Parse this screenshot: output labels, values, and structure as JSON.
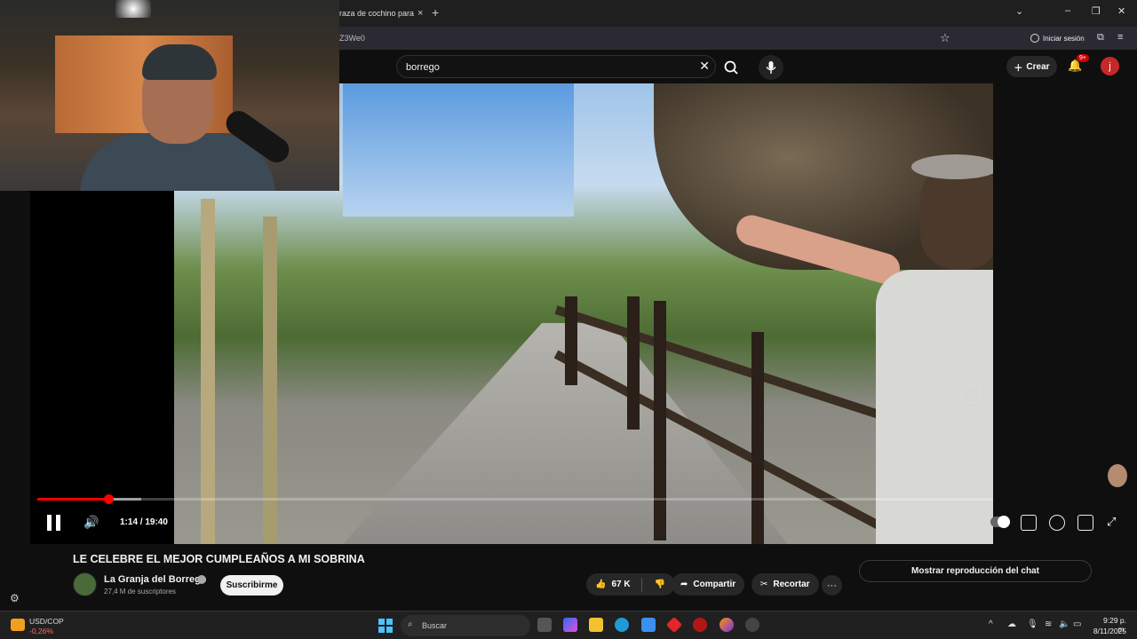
{
  "browser": {
    "tab_title": "raza de cochino para s",
    "tab_close": "×",
    "new_tab": "+",
    "url": "Z3We0",
    "sign_in": "Iniciar sesión",
    "window_controls": [
      "⌄",
      "–",
      "❐",
      "✕"
    ]
  },
  "youtube_header": {
    "search_value": "borrego",
    "create_label": "Crear",
    "notifications_badge": "9+",
    "account_initial": "j"
  },
  "player": {
    "time": "1:14 / 19:40",
    "progress_fraction": 0.074,
    "buffer_fraction": 0.109
  },
  "video": {
    "title": "LE CELEBRE EL MEJOR CUMPLEAÑOS A MI SOBRINA",
    "channel_name": "La Granja del Borrego",
    "subscribers": "27,4 M de suscriptores",
    "subscribe_label": "Suscribirme",
    "likes": "67 K",
    "share_label": "Compartir",
    "clip_label": "Recortar",
    "more_label": "···",
    "show_chat_label": "Mostrar reproducción del chat"
  },
  "taskbar": {
    "ticker_name": "USD/COP",
    "ticker_change": "-0,26%",
    "search_label": "Buscar",
    "clock_time": "9:29 p. m.",
    "clock_date": "8/11/2025"
  },
  "colors": {
    "accent_red": "#ff0000",
    "background": "#0f0f0f",
    "windows_blue": "#4cc2ff"
  }
}
